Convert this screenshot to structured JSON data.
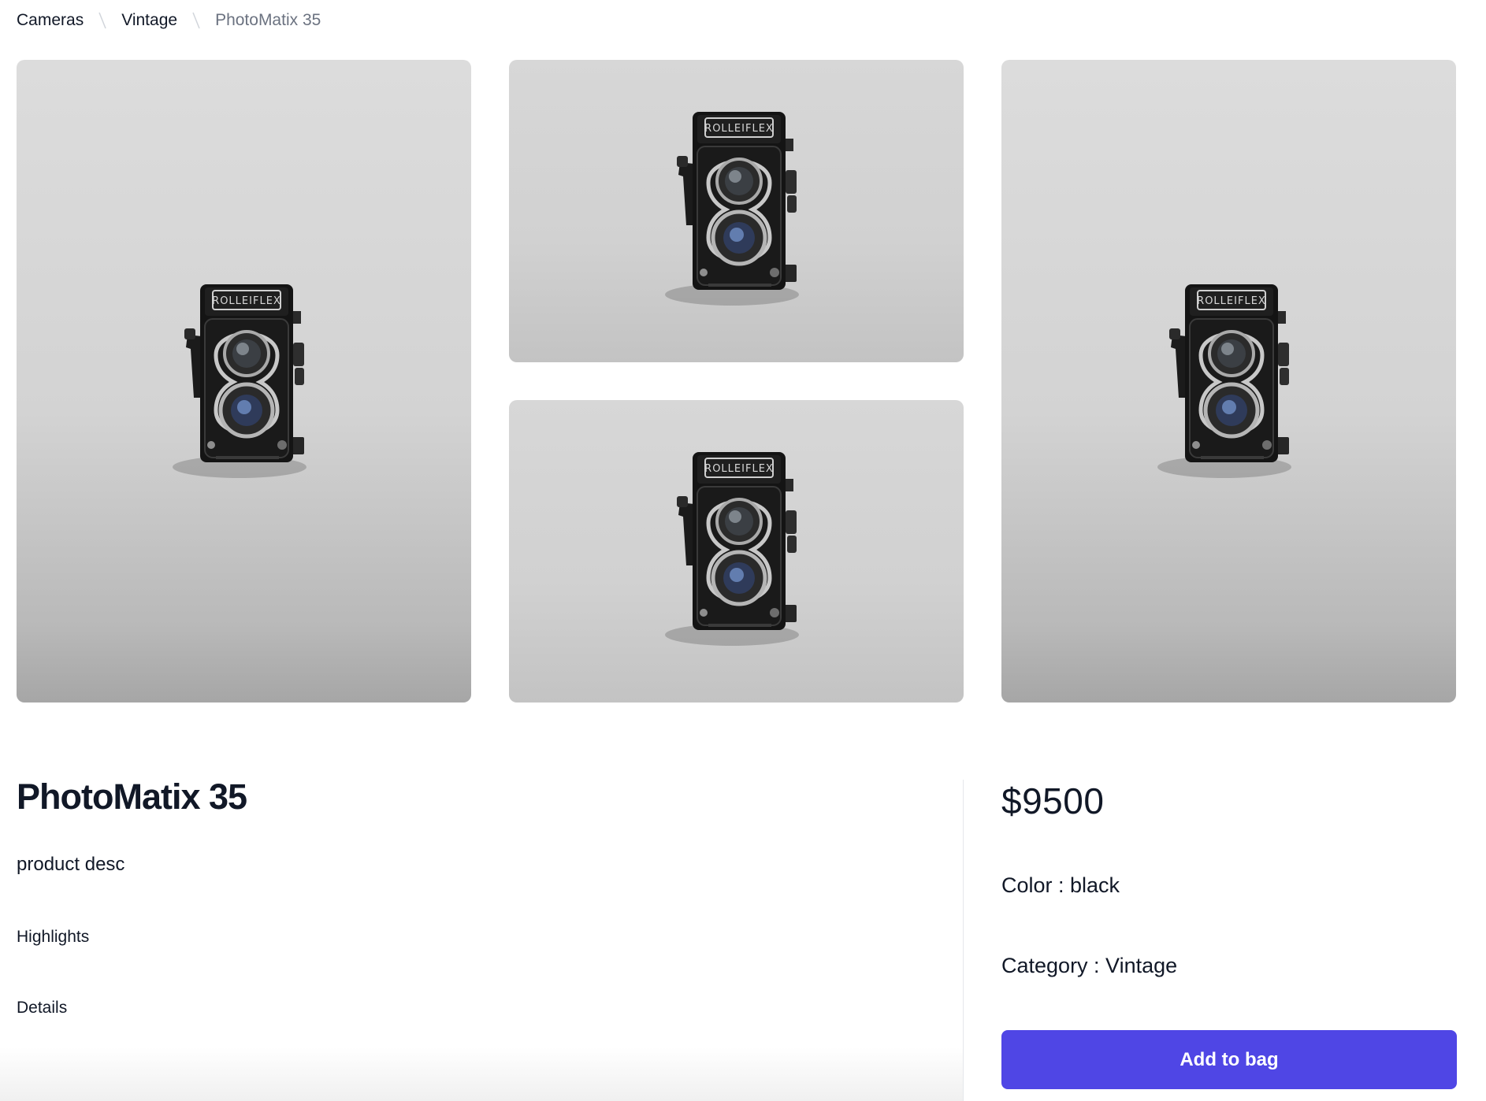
{
  "breadcrumb": {
    "items": [
      "Cameras",
      "Vintage"
    ],
    "current": "PhotoMatix 35"
  },
  "gallery": {
    "images": [
      {
        "subject": "Rolleiflex twin-lens camera",
        "label": "ROLLEIFLEX"
      },
      {
        "subject": "Rolleiflex twin-lens camera",
        "label": "ROLLEIFLEX"
      },
      {
        "subject": "Rolleiflex twin-lens camera",
        "label": "ROLLEIFLEX"
      },
      {
        "subject": "Rolleiflex twin-lens camera",
        "label": "ROLLEIFLEX"
      }
    ]
  },
  "product": {
    "name": "PhotoMatix 35",
    "description": "product desc",
    "highlights_label": "Highlights",
    "details_label": "Details",
    "price": "$9500",
    "color_line": "Color : black",
    "category_line": "Category : Vintage",
    "add_to_bag_label": "Add to bag"
  },
  "colors": {
    "accent": "#4f46e5",
    "text_primary": "#111827",
    "text_muted": "#6b7280",
    "divider": "#e5e7eb"
  },
  "icons": {
    "breadcrumb_separator": "backslash-divider-icon"
  }
}
